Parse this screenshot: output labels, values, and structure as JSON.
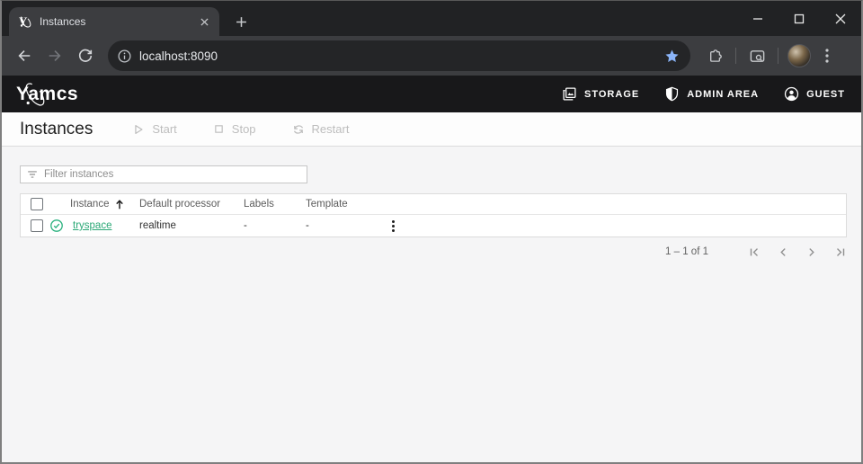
{
  "browser": {
    "tab_title": "Instances",
    "url": "localhost:8090"
  },
  "app_header": {
    "logo_text": "Yamcs",
    "nav_items": [
      {
        "label": "STORAGE",
        "icon": "storage-icon"
      },
      {
        "label": "ADMIN AREA",
        "icon": "shield-icon"
      },
      {
        "label": "GUEST",
        "icon": "account-circle-icon"
      }
    ]
  },
  "page_header": {
    "title": "Instances",
    "actions": [
      {
        "label": "Start",
        "icon": "play-icon",
        "enabled": false
      },
      {
        "label": "Stop",
        "icon": "stop-icon",
        "enabled": false
      },
      {
        "label": "Restart",
        "icon": "restart-icon",
        "enabled": false
      }
    ]
  },
  "filter": {
    "placeholder": "Filter instances"
  },
  "instances_table": {
    "columns": [
      "Instance",
      "Default processor",
      "Labels",
      "Template"
    ],
    "sort": {
      "column": "Instance",
      "direction": "asc"
    },
    "rows": [
      {
        "state": "running",
        "instance": "tryspace",
        "default_processor": "realtime",
        "labels": "-",
        "template": "-"
      }
    ]
  },
  "paginator": {
    "range_label": "1 – 1 of 1"
  },
  "colors": {
    "accent_green": "#2ab17e",
    "link_green": "#2aa876",
    "bookmark_star_blue": "#8ab4f8",
    "app_bar_bg": "#18181a",
    "chrome_frame_bg": "#212224",
    "chrome_toolbar_bg": "#3c3d40",
    "page_bg": "#f5f5f6"
  }
}
